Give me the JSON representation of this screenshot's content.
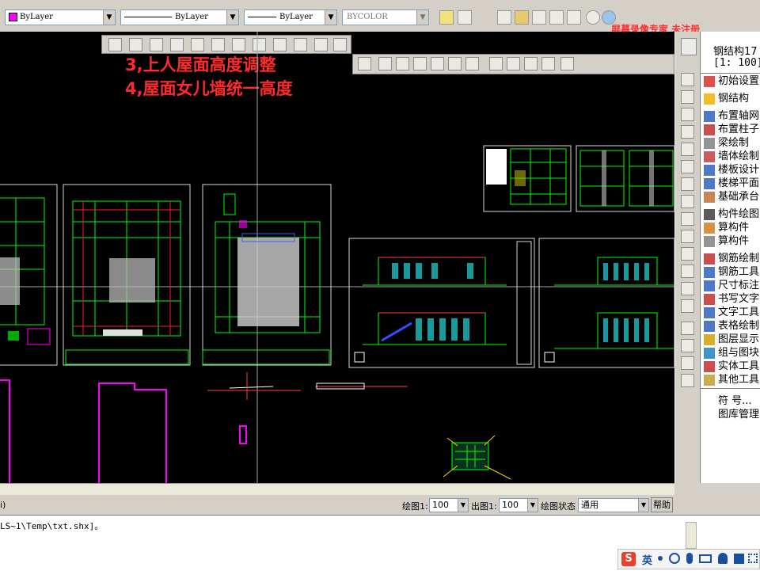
{
  "properties_toolbar": {
    "color_value": "ByLayer",
    "linetype_value": "ByLayer",
    "lineweight_value": "ByLayer",
    "plotstyle_value": "BYCOLOR",
    "color_swatch": "#ff00ff"
  },
  "watermark": "屏幕录像专家 未注册",
  "annotations": {
    "line3": "3,上人屋面高度调整",
    "line4": "4,屋面女儿墙统一高度"
  },
  "panel": {
    "header_title": "钢结构17",
    "header_scale": "[1: 100]",
    "items": [
      {
        "label": "初始设置",
        "icon": "settings-icon"
      },
      {
        "label": "钢结构",
        "icon": "structure-icon"
      },
      {
        "label": "布置轴网",
        "icon": "grid-icon"
      },
      {
        "label": "布置柱子",
        "icon": "column-icon"
      },
      {
        "label": "梁绘制",
        "icon": "beam-icon"
      },
      {
        "label": "墙体绘制",
        "icon": "wall-icon"
      },
      {
        "label": "楼板设计",
        "icon": "slab-icon"
      },
      {
        "label": "楼梯平面",
        "icon": "stair-icon"
      },
      {
        "label": "基础承台",
        "icon": "foundation-icon"
      },
      {
        "label": "构件绘图",
        "icon": "member-icon"
      },
      {
        "label": "算构件",
        "icon": "calc-icon"
      },
      {
        "label": "算构件",
        "icon": "calc2-icon"
      },
      {
        "label": "钢筋绘制",
        "icon": "rebar-icon"
      },
      {
        "label": "钢筋工具",
        "icon": "rebar-tool-icon"
      },
      {
        "label": "尺寸标注",
        "icon": "dimension-icon"
      },
      {
        "label": "书写文字",
        "icon": "text-write-icon"
      },
      {
        "label": "文字工具",
        "icon": "text-tool-icon"
      },
      {
        "label": "表格绘制",
        "icon": "table-icon"
      },
      {
        "label": "图层显示",
        "icon": "layer-icon"
      },
      {
        "label": "组与图块",
        "icon": "block-icon"
      },
      {
        "label": "实体工具",
        "icon": "entity-icon"
      },
      {
        "label": "其他工具",
        "icon": "other-tool-icon"
      }
    ],
    "footer_items": [
      "符 号...",
      "图库管理"
    ]
  },
  "status_bar": {
    "left_fragment": "i)",
    "drawing_scale_label": "绘图1:",
    "drawing_scale_value": "100",
    "output_scale_label": "出图1:",
    "output_scale_value": "100",
    "state_label": "绘图状态",
    "state_value": "通用",
    "help_label": "帮助"
  },
  "command_line": {
    "text": "LS~1\\Temp\\txt.shx]。"
  },
  "taskbar": {
    "ime_label": "英"
  }
}
